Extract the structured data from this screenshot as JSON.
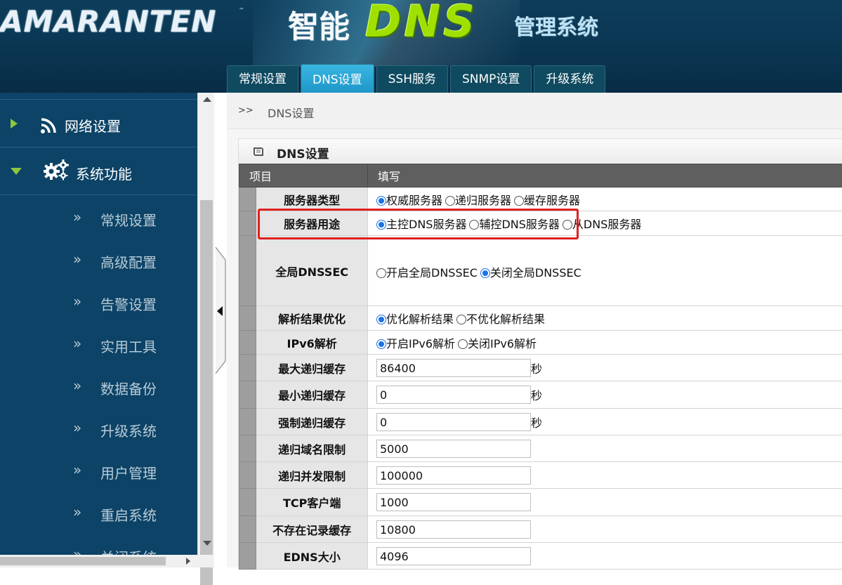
{
  "header": {
    "brand": "AMARANTEN",
    "brand_tm": "™",
    "zhineng": "智能",
    "dns": "DNS",
    "system": "管理系统"
  },
  "tabs": [
    {
      "label": "常规设置",
      "active": false
    },
    {
      "label": "DNS设置",
      "active": true
    },
    {
      "label": "SSH服务",
      "active": false
    },
    {
      "label": "SNMP设置",
      "active": false
    },
    {
      "label": "升级系统",
      "active": false
    }
  ],
  "sidebar": {
    "groups": [
      {
        "label": "网络设置",
        "icon": "rss-icon",
        "expanded": false
      },
      {
        "label": "系统功能",
        "icon": "gears-icon",
        "expanded": true
      }
    ],
    "items": [
      "常规设置",
      "高级配置",
      "告警设置",
      "实用工具",
      "数据备份",
      "升级系统",
      "用户管理",
      "重启系统",
      "关闭系统"
    ],
    "chevron": "»"
  },
  "breadcrumb": {
    "separator": ">>",
    "current": "DNS设置"
  },
  "panel": {
    "title": "DNS设置",
    "col_item": "项目",
    "col_fill": "填写"
  },
  "rows": {
    "server_type": {
      "label": "服务器类型",
      "options": [
        {
          "label": "权威服务器",
          "checked": true
        },
        {
          "label": "递归服务器",
          "checked": false
        },
        {
          "label": "缓存服务器",
          "checked": false
        }
      ]
    },
    "server_use": {
      "label": "服务器用途",
      "options": [
        {
          "label": "主控DNS服务器",
          "checked": true
        },
        {
          "label": "辅控DNS服务器",
          "checked": false
        },
        {
          "label": "从DNS服务器",
          "checked": false
        }
      ]
    },
    "dnssec": {
      "label": "全局DNSSEC",
      "options": [
        {
          "label": "开启全局DNSSEC",
          "checked": false
        },
        {
          "label": "关闭全局DNSSEC",
          "checked": true
        }
      ]
    },
    "optimize": {
      "label": "解析结果优化",
      "options": [
        {
          "label": "优化解析结果",
          "checked": true
        },
        {
          "label": "不优化解析结果",
          "checked": false
        }
      ]
    },
    "ipv6": {
      "label": "IPv6解析",
      "options": [
        {
          "label": "开启IPv6解析",
          "checked": true
        },
        {
          "label": "关闭IPv6解析",
          "checked": false
        }
      ]
    },
    "max_cache": {
      "label": "最大递归缓存",
      "value": "86400",
      "unit": "秒"
    },
    "min_cache": {
      "label": "最小递归缓存",
      "value": "0",
      "unit": "秒"
    },
    "force_cache": {
      "label": "强制递归缓存",
      "value": "0",
      "unit": "秒"
    },
    "domain_limit": {
      "label": "递归域名限制",
      "value": "5000"
    },
    "concurrency": {
      "label": "递归并发限制",
      "value": "100000"
    },
    "tcp_clients": {
      "label": "TCP客户端",
      "value": "1000"
    },
    "negative_cache": {
      "label": "不存在记录缓存",
      "value": "10800"
    },
    "edns_size": {
      "label": "EDNS大小",
      "value": "4096"
    }
  },
  "colors": {
    "header_bg": "#0b3a56",
    "sidebar_bg": "#0c4366",
    "tab_active": "#2aa6d8",
    "highlight": "#e02020",
    "radio_checked": "#1a73e8"
  }
}
